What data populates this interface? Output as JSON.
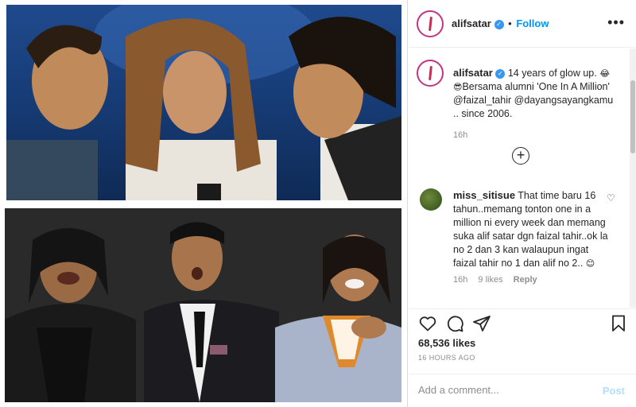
{
  "post": {
    "username": "alifsatar",
    "follow_label": "Follow",
    "caption_line1": "14 years of glow up.",
    "caption_emoji1": "😂",
    "caption_emoji2": "😎",
    "caption_line2": "Bersama alumni 'One In A Million'",
    "mention1": "@faizal_tahir",
    "mention2": "@dayangsayangkamu",
    "caption_line3": ".. since 2006.",
    "caption_time": "16h"
  },
  "comment": {
    "username": "miss_sitisue",
    "text": "That time baru 16 tahun..memang tonton one in a million ni every week dan memang suka alif satar dgn faizal tahir..ok la no 2 dan 3 kan walaupun ingat faizal tahir no 1 dan alif no 2..",
    "emoji": "😊",
    "time": "16h",
    "likes": "9 likes",
    "reply_label": "Reply"
  },
  "stats": {
    "likes": "68,536 likes",
    "timestamp": "16 HOURS AGO"
  },
  "composer": {
    "placeholder": "Add a comment...",
    "post_label": "Post"
  },
  "icons": {
    "verified": "verified-badge-icon",
    "more": "more-options-icon",
    "plus": "load-more-comments-icon",
    "like": "heart-icon",
    "comment": "comment-icon",
    "share": "share-icon",
    "save": "bookmark-icon"
  },
  "colors": {
    "link": "#0095f6",
    "verified": "#3897f0",
    "post_disabled": "#b2dffc"
  }
}
